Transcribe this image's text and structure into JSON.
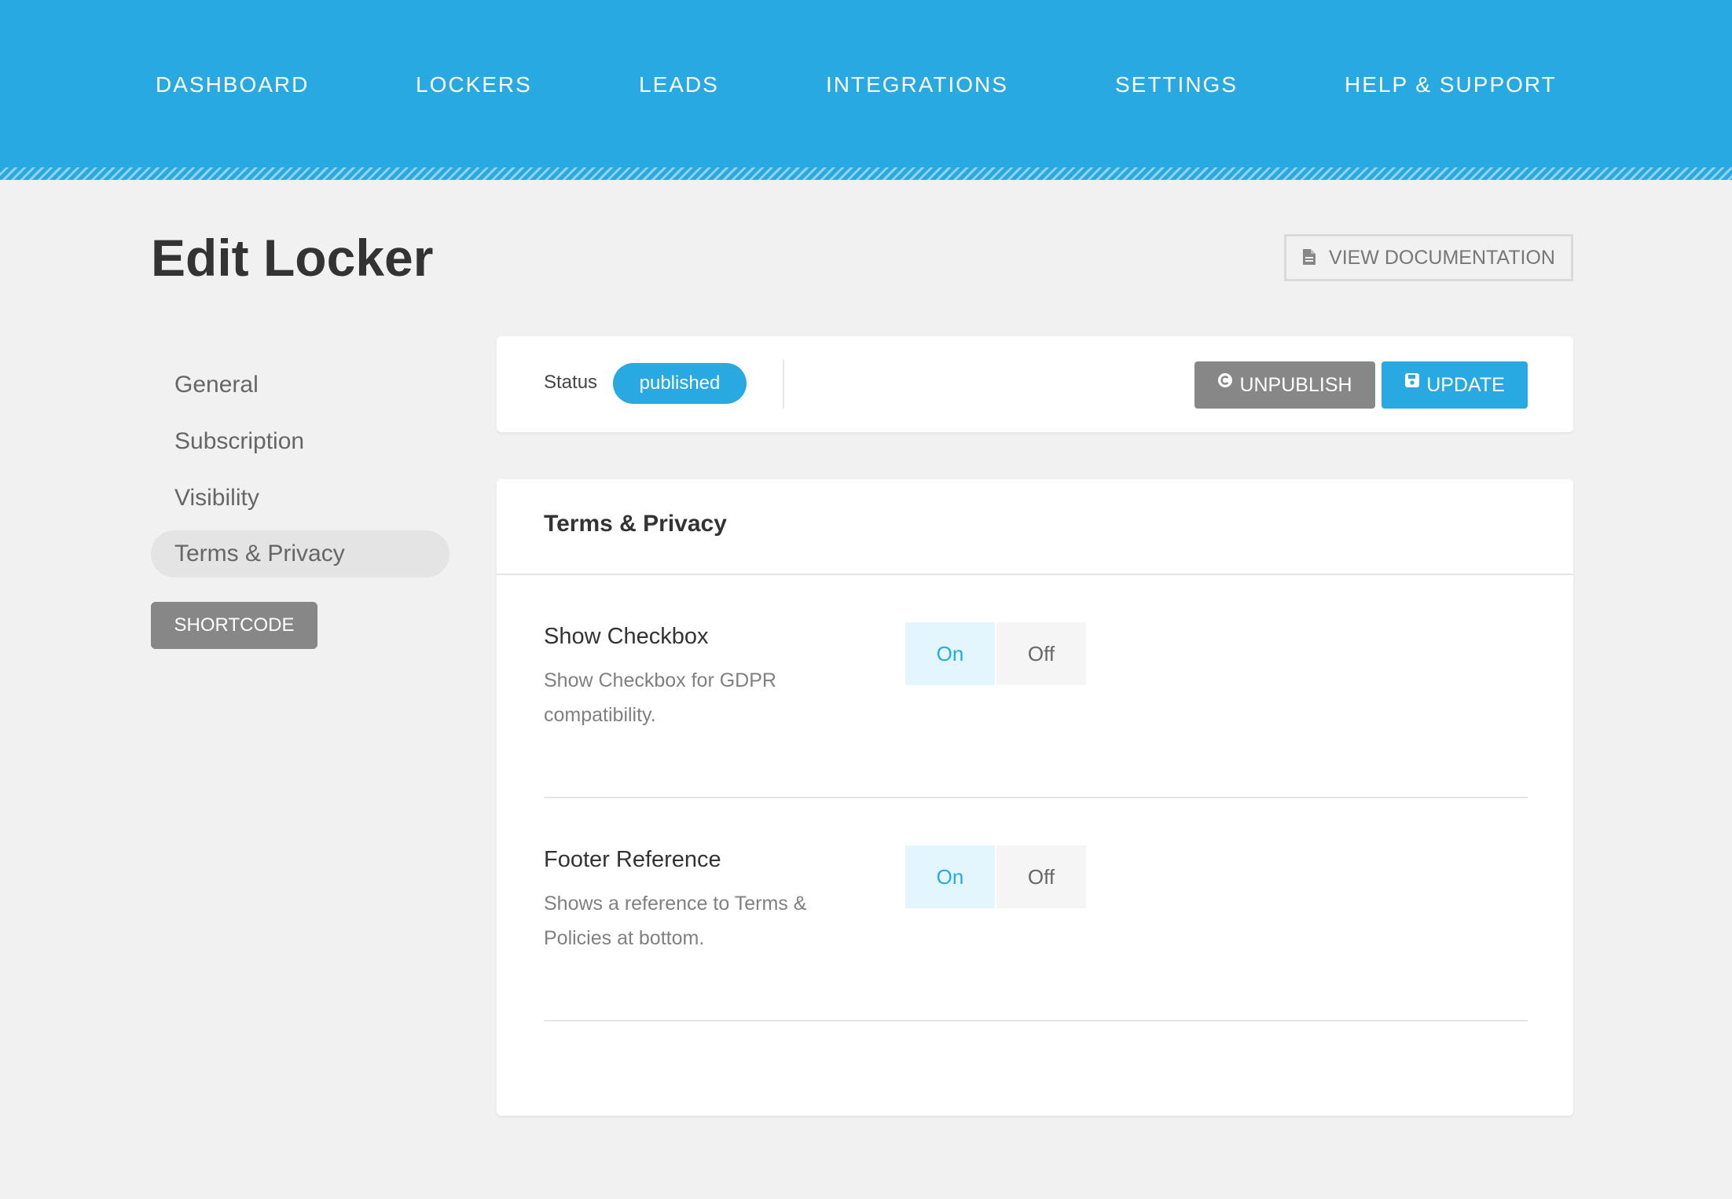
{
  "nav": {
    "items": [
      {
        "label": "DASHBOARD"
      },
      {
        "label": "LOCKERS"
      },
      {
        "label": "LEADS"
      },
      {
        "label": "INTEGRATIONS"
      },
      {
        "label": "SETTINGS"
      },
      {
        "label": "HELP & SUPPORT"
      }
    ]
  },
  "header": {
    "title": "Edit Locker",
    "doc_button_label": "VIEW DOCUMENTATION"
  },
  "sidebar": {
    "items": [
      {
        "label": "General"
      },
      {
        "label": "Subscription"
      },
      {
        "label": "Visibility"
      },
      {
        "label": "Terms & Privacy",
        "active": true
      }
    ],
    "shortcode_label": "SHORTCODE"
  },
  "status": {
    "label": "Status",
    "value": "published",
    "unpublish_label": "UNPUBLISH",
    "update_label": "UPDATE"
  },
  "section": {
    "title": "Terms & Privacy",
    "options": [
      {
        "title": "Show Checkbox",
        "description": "Show Checkbox for GDPR compatibility.",
        "on_label": "On",
        "off_label": "Off",
        "selected": "On"
      },
      {
        "title": "Footer Reference",
        "description": "Shows a reference to Terms & Policies at bottom.",
        "on_label": "On",
        "off_label": "Off",
        "selected": "On"
      }
    ]
  },
  "colors": {
    "brand": "#28a9e1",
    "secondary_button": "#878787",
    "background": "#f1f1f1"
  }
}
